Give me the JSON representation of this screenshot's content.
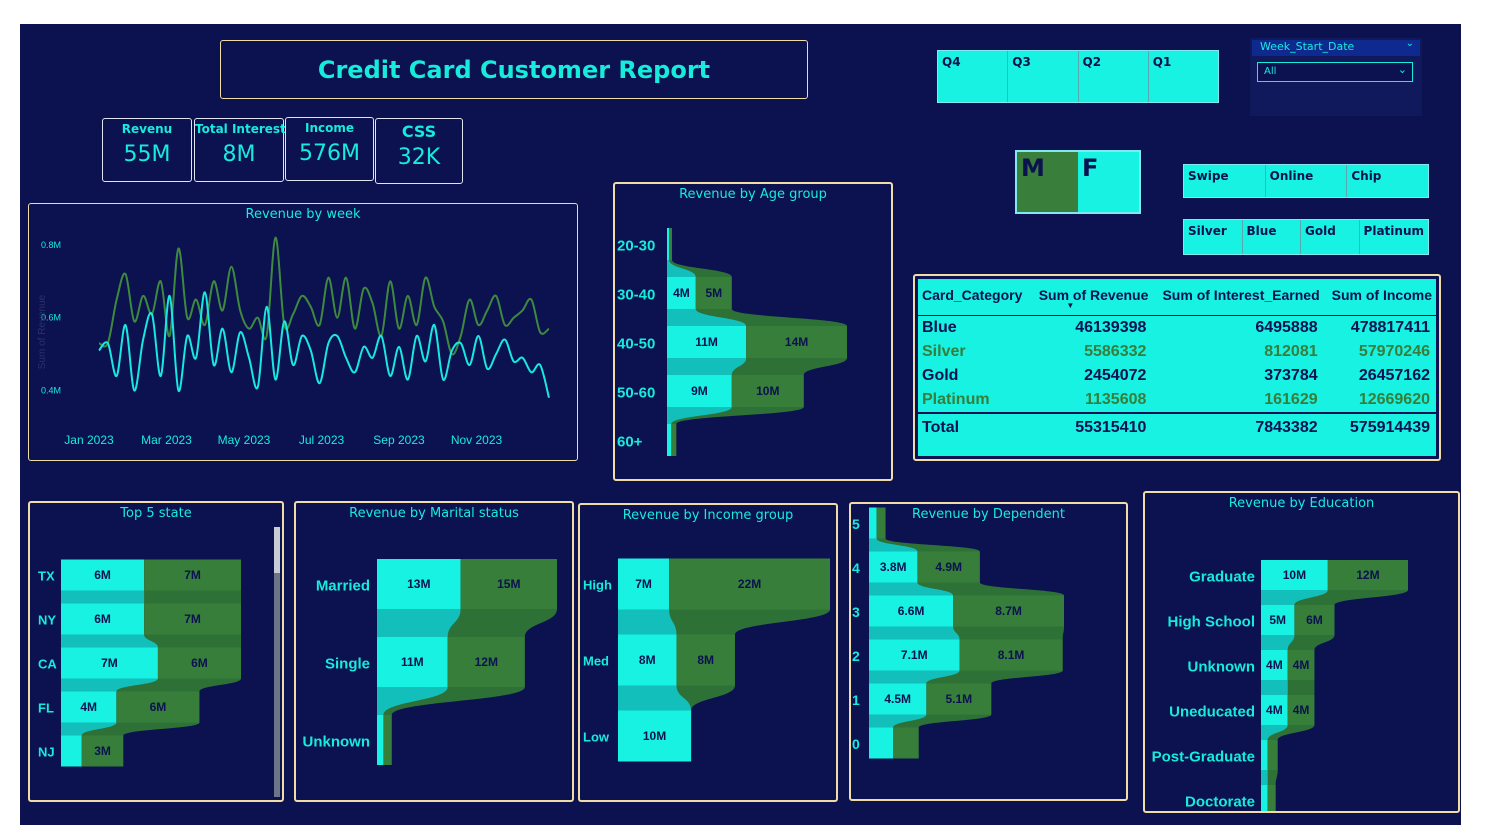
{
  "report": {
    "title": "Credit Card Customer Report"
  },
  "kpis": [
    {
      "label": "Revenu",
      "value": "55M"
    },
    {
      "label": "Total Interest",
      "value": "8M"
    },
    {
      "label": "Income",
      "value": "576M"
    },
    {
      "label": "CSS",
      "value": "32K"
    }
  ],
  "slicers": {
    "quarters": [
      "Q4",
      "Q3",
      "Q2",
      "Q1"
    ],
    "gender": [
      "M",
      "F"
    ],
    "use_chip": [
      "Swipe",
      "Online",
      "Chip"
    ],
    "card_category": [
      "Silver",
      "Blue",
      "Gold",
      "Platinum"
    ],
    "week_start": {
      "label": "Week_Start_Date",
      "value": "All"
    }
  },
  "colors": {
    "background": "#0c1150",
    "cyan": "#17f2e2",
    "green": "#367e3a",
    "gold_border": "#efdca6"
  },
  "card_table": {
    "headers": [
      "Card_Category",
      "Sum of Revenue",
      "Sum of Interest_Earned",
      "Sum of Income"
    ],
    "rows": [
      {
        "cells": [
          "Blue",
          "46139398",
          "6495888",
          "478817411"
        ],
        "color": "#0c1150"
      },
      {
        "cells": [
          "Silver",
          "5586332",
          "812081",
          "57970246"
        ],
        "color": "#367e3a"
      },
      {
        "cells": [
          "Gold",
          "2454072",
          "373784",
          "26457162"
        ],
        "color": "#0c1150"
      },
      {
        "cells": [
          "Platinum",
          "1135608",
          "161629",
          "12669620"
        ],
        "color": "#367e3a"
      }
    ],
    "total": [
      "Total",
      "55315410",
      "7843382",
      "575914439"
    ]
  },
  "chart_data": [
    {
      "id": "revenue-by-week",
      "type": "line",
      "title": "Revenue by week",
      "ylabel": "Sum of Revenue",
      "ylim": [
        0.33,
        0.83
      ],
      "yticks": [
        0.4,
        0.6,
        0.8
      ],
      "ytick_labels": [
        "0.4M",
        "0.6M",
        "0.8M"
      ],
      "xtick_labels": [
        "Jan 2023",
        "Mar 2023",
        "May 2023",
        "Jul 2023",
        "Sep 2023",
        "Nov 2023"
      ],
      "x": [
        1,
        2,
        3,
        4,
        5,
        6,
        7,
        8,
        9,
        10,
        11,
        12,
        13,
        14,
        15,
        16,
        17,
        18,
        19,
        20,
        21,
        22,
        23,
        24,
        25,
        26,
        27,
        28,
        29,
        30,
        31,
        32,
        33,
        34,
        35,
        36,
        37,
        38,
        39,
        40,
        41,
        42,
        43,
        44,
        45,
        46,
        47,
        48,
        49,
        50,
        51,
        52
      ],
      "series": [
        {
          "color": "#3d8a3e",
          "values": [
            0.53,
            0.53,
            0.65,
            0.72,
            0.59,
            0.66,
            0.61,
            0.7,
            0.55,
            0.79,
            0.6,
            0.65,
            0.58,
            0.7,
            0.62,
            0.74,
            0.62,
            0.57,
            0.6,
            0.55,
            0.82,
            0.58,
            0.61,
            0.66,
            0.63,
            0.58,
            0.71,
            0.6,
            0.71,
            0.57,
            0.68,
            0.64,
            0.55,
            0.7,
            0.57,
            0.66,
            0.58,
            0.71,
            0.63,
            0.59,
            0.5,
            0.55,
            0.65,
            0.58,
            0.62,
            0.66,
            0.58,
            0.6,
            0.62,
            0.65,
            0.56,
            0.57
          ]
        },
        {
          "color": "#17e8e0",
          "values": [
            0.51,
            0.53,
            0.44,
            0.58,
            0.4,
            0.54,
            0.61,
            0.44,
            0.66,
            0.4,
            0.55,
            0.49,
            0.67,
            0.47,
            0.57,
            0.45,
            0.56,
            0.49,
            0.41,
            0.63,
            0.43,
            0.59,
            0.47,
            0.55,
            0.51,
            0.42,
            0.53,
            0.55,
            0.49,
            0.45,
            0.52,
            0.49,
            0.55,
            0.44,
            0.52,
            0.43,
            0.55,
            0.48,
            0.58,
            0.43,
            0.51,
            0.53,
            0.47,
            0.55,
            0.46,
            0.5,
            0.54,
            0.48,
            0.49,
            0.45,
            0.47,
            0.38
          ]
        }
      ]
    },
    {
      "id": "revenue-by-age-group",
      "type": "bar",
      "title": "Revenue by Age group",
      "categories": [
        "20-30",
        "30-40",
        "40-50",
        "50-60",
        "60+"
      ],
      "series": [
        {
          "color": "#17f2e2",
          "values": [
            0.3,
            4.0,
            11.0,
            9.0,
            0.6
          ],
          "labels": [
            "",
            "4M",
            "11M",
            "9M",
            ""
          ]
        },
        {
          "color": "#367e3a",
          "values": [
            0.4,
            5.0,
            14.0,
            10.0,
            0.7
          ],
          "labels": [
            "",
            "5M",
            "14M",
            "10M",
            ""
          ]
        }
      ]
    },
    {
      "id": "top-5-state",
      "type": "bar",
      "title": "Top 5 state",
      "categories": [
        "TX",
        "NY",
        "CA",
        "FL",
        "NJ"
      ],
      "series": [
        {
          "color": "#17f2e2",
          "values": [
            6,
            6,
            7,
            4,
            1.5
          ],
          "labels": [
            "6M",
            "6M",
            "7M",
            "4M",
            ""
          ]
        },
        {
          "color": "#367e3a",
          "values": [
            7,
            7,
            6,
            6,
            3
          ],
          "labels": [
            "7M",
            "7M",
            "6M",
            "6M",
            "3M"
          ]
        }
      ]
    },
    {
      "id": "revenue-by-marital-status",
      "type": "bar",
      "title": "Revenue by Marital status",
      "categories": [
        "Married",
        "Single",
        "Unknown"
      ],
      "series": [
        {
          "color": "#17f2e2",
          "values": [
            13,
            11,
            1
          ],
          "labels": [
            "13M",
            "11M",
            ""
          ]
        },
        {
          "color": "#367e3a",
          "values": [
            15,
            12,
            1.3
          ],
          "labels": [
            "15M",
            "12M",
            ""
          ]
        }
      ]
    },
    {
      "id": "revenue-by-income-group",
      "type": "bar",
      "title": "Revenue by Income group",
      "categories": [
        "High",
        "Med",
        "Low"
      ],
      "series": [
        {
          "color": "#17f2e2",
          "values": [
            7,
            8,
            10
          ],
          "labels": [
            "7M",
            "8M",
            "10M"
          ]
        },
        {
          "color": "#367e3a",
          "values": [
            22,
            8,
            0
          ],
          "labels": [
            "22M",
            "8M",
            ""
          ]
        }
      ]
    },
    {
      "id": "revenue-by-dependent",
      "type": "bar",
      "title": "Revenue by Dependent",
      "categories": [
        "5",
        "4",
        "3",
        "2",
        "1",
        "0"
      ],
      "series": [
        {
          "color": "#17f2e2",
          "values": [
            0.6,
            3.8,
            6.6,
            7.1,
            4.5,
            1.9
          ],
          "labels": [
            "",
            "3.8M",
            "6.6M",
            "7.1M",
            "4.5M",
            ""
          ]
        },
        {
          "color": "#367e3a",
          "values": [
            0.7,
            4.9,
            8.7,
            8.1,
            5.1,
            2.0
          ],
          "labels": [
            "",
            "4.9M",
            "8.7M",
            "8.1M",
            "5.1M",
            ""
          ]
        }
      ]
    },
    {
      "id": "revenue-by-education",
      "type": "bar",
      "title": "Revenue by Education",
      "categories": [
        "Graduate",
        "High School",
        "Unknown",
        "Uneducated",
        "Post-Graduate",
        "Doctorate"
      ],
      "series": [
        {
          "color": "#17f2e2",
          "values": [
            10,
            5,
            4,
            4,
            1,
            1
          ],
          "labels": [
            "10M",
            "5M",
            "4M",
            "4M",
            "",
            ""
          ]
        },
        {
          "color": "#367e3a",
          "values": [
            12,
            6,
            4,
            4,
            1.5,
            1.2
          ],
          "labels": [
            "12M",
            "6M",
            "4M",
            "4M",
            "",
            ""
          ]
        }
      ]
    }
  ]
}
